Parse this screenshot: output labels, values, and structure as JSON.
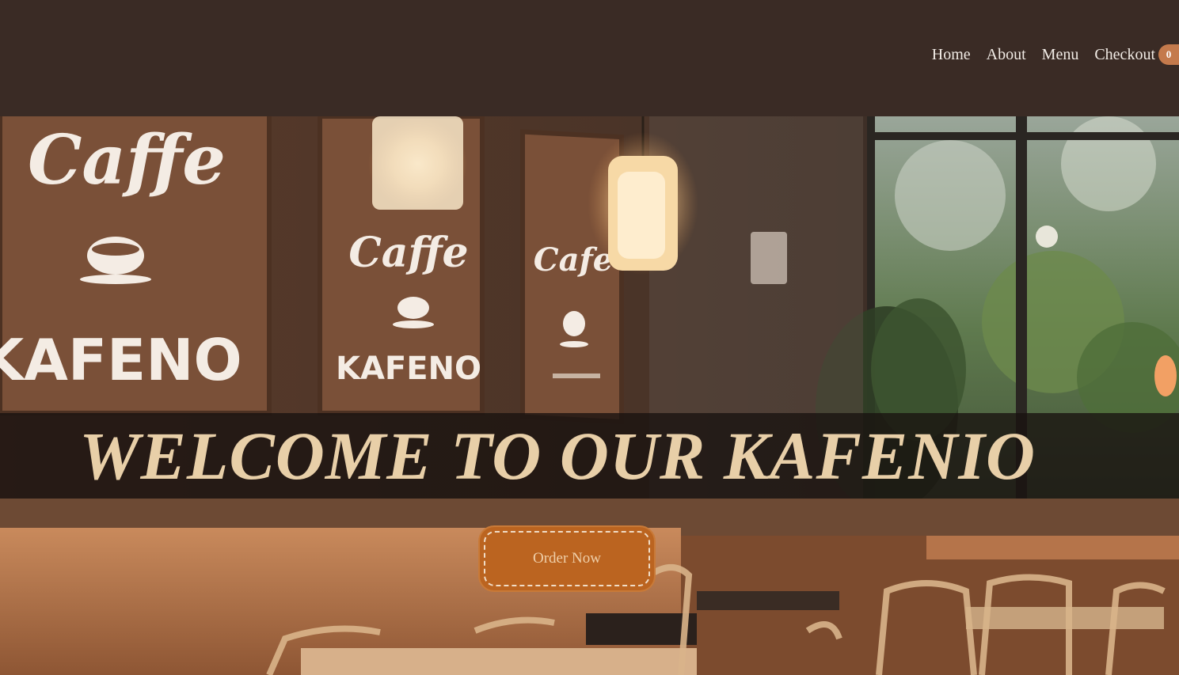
{
  "nav": {
    "items": [
      {
        "label": "Home"
      },
      {
        "label": "About"
      },
      {
        "label": "Menu"
      },
      {
        "label": "Checkout"
      }
    ],
    "cart_count": "0"
  },
  "hero": {
    "title": "WELCOME TO OUR KAFENIO",
    "cta_label": "Order Now",
    "sign_lines": {
      "sign1_top": "Caffe",
      "sign1_bottom": "KAFENO",
      "sign2_top": "Caffe",
      "sign2_bottom": "KAFENO",
      "sign3_top": "Cafe"
    }
  },
  "colors": {
    "header_bg": "#3a2b25",
    "accent": "#c47a4c",
    "title_text": "#e8cfa8",
    "button_bg": "#bb6420"
  }
}
